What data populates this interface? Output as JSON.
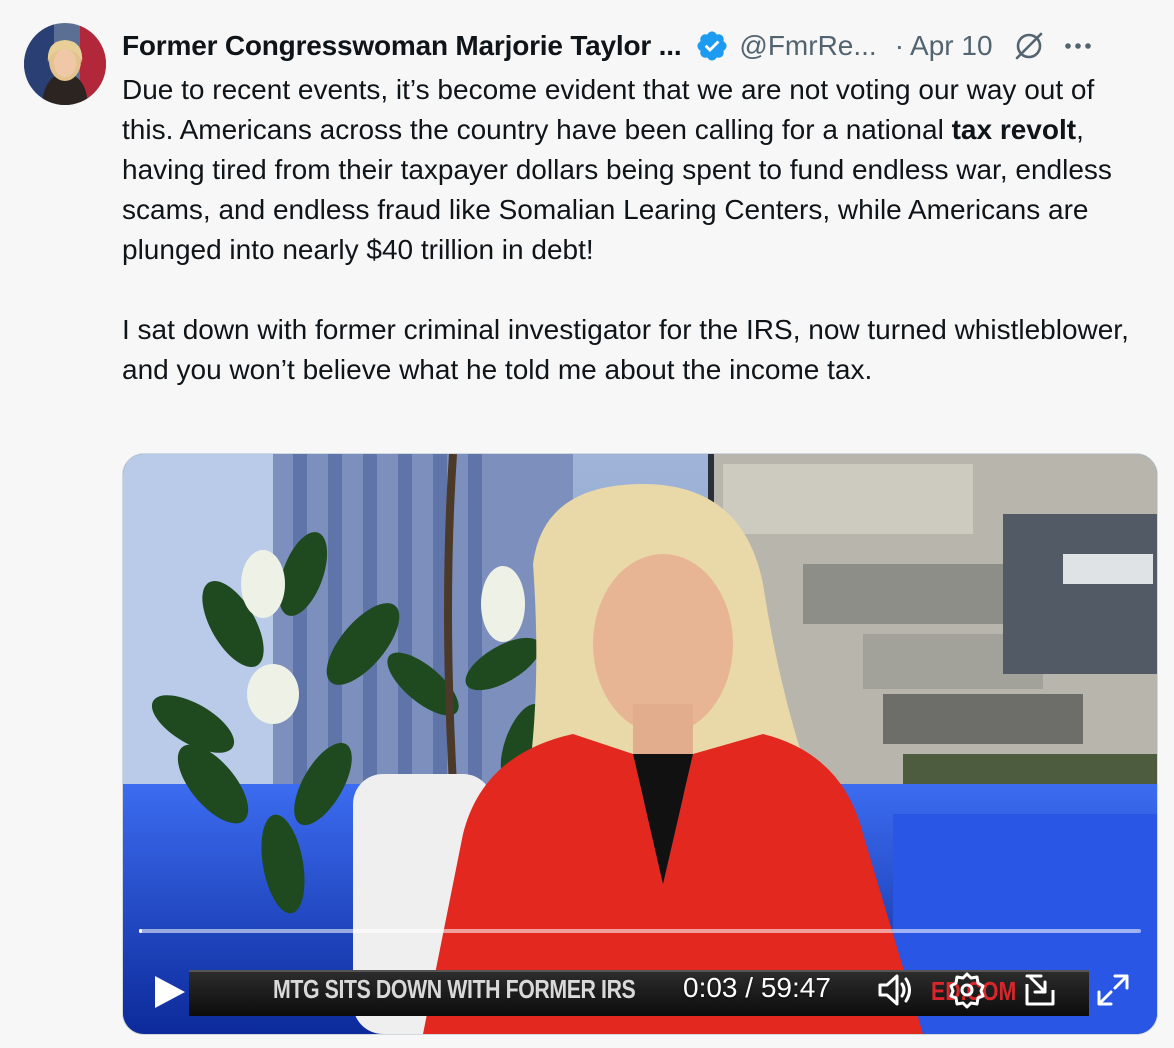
{
  "author": {
    "name": "Former Congresswoman Marjorie Taylor ...",
    "handle": "@FmrRe...",
    "separator": "·",
    "date": "Apr 10",
    "avatar_icon": "avatar",
    "verified_icon": "verified-badge-icon"
  },
  "tweet": {
    "p1_before": "Due to recent events, it’s become evident that we are not voting our way out of this. Americans across the country have been calling for a national ",
    "p1_bold": "tax revolt",
    "p1_after": ", having tired from their taxpayer dollars being spent to fund endless war, endless scams, and endless fraud like Somalian Learing Centers, while Americans are plunged into nearly $40 trillion in debt!",
    "p2": "I sat down with former criminal investigator for the IRS, now turned whistleblower, and you won’t believe what he told me about the income tax."
  },
  "video": {
    "banner_text": "MTG SITS DOWN WITH FORMER IRS",
    "banner_right_text": "ED.COM",
    "current_time": "0:03",
    "separator": " / ",
    "duration": "59:47",
    "progress": 0.0008,
    "accent_color": "#ffffff"
  },
  "colors": {
    "background": "#f7f7f7",
    "text": "#0f1419",
    "secondary_text": "#536471",
    "verified_blue": "#1d9bf0"
  }
}
